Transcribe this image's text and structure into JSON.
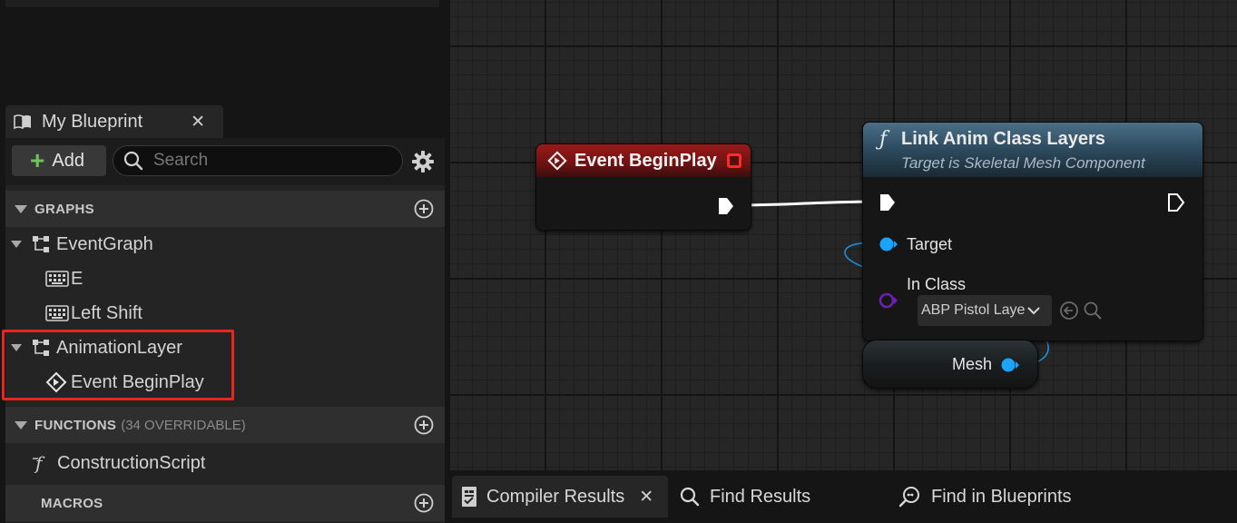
{
  "panel_tab": {
    "label": "My Blueprint",
    "close": "✕"
  },
  "toolbar": {
    "add_label": "Add",
    "search_placeholder": "Search"
  },
  "sections": {
    "graphs": "GRAPHS",
    "functions": "FUNCTIONS",
    "functions_sub": "(34 OVERRIDABLE)",
    "macros": "MACROS"
  },
  "tree": {
    "event_graph": "EventGraph",
    "key_e": "E",
    "key_left_shift": "Left Shift",
    "animation_layer": "AnimationLayer",
    "event_begin_play": "Event BeginPlay",
    "construction_script": "ConstructionScript"
  },
  "graph": {
    "event_node": {
      "title": "Event BeginPlay"
    },
    "func_node": {
      "title": "Link Anim Class Layers",
      "subtitle": "Target is Skeletal Mesh Component",
      "target_pin": "Target",
      "in_class_pin": "In Class",
      "in_class_value": "ABP Pistol Layer"
    },
    "mesh_node": {
      "label": "Mesh"
    }
  },
  "bottom_tabs": {
    "compiler_results": "Compiler Results",
    "find_results": "Find Results",
    "find_in_blueprints": "Find in Blueprints",
    "close": "✕"
  },
  "colors": {
    "exec_pin": "#ffffff",
    "object_pin": "#1aa3ff",
    "class_pin": "#6e1fb3",
    "highlight": "#e8261f",
    "add_plus": "#6dc25d"
  }
}
